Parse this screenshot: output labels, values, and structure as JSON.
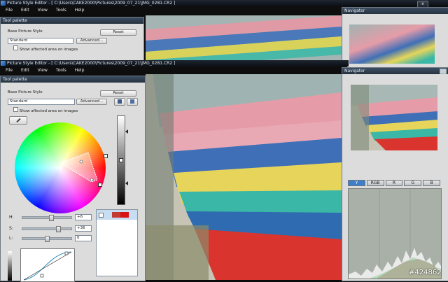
{
  "app": {
    "title_back": "Picture Style Editor - [ C:\\Users\\CAKE2000\\Pictures\\2009_07_21\\JMG_0281.CR2 ]",
    "title_front": "Picture Style Editor - [ C:\\Users\\CAKE2000\\Pictures\\2009_07_21\\JMG_0281.CR2 ]",
    "menu": [
      "File",
      "Edit",
      "View",
      "Tools",
      "Help"
    ],
    "window_buttons": {
      "minimize": "–",
      "maximize": "□",
      "close": "x"
    }
  },
  "tool_palette": {
    "title": "Tool palette",
    "base_style_label": "Base Picture Style",
    "reset_label": "Reset",
    "base_style_value": "Standard",
    "advanced_label": "Advanced...",
    "show_affected_label": "Show affected area on images",
    "h_label": "H:",
    "h_value": "+6",
    "s_label": "S:",
    "s_value": "+36",
    "l_label": "L:",
    "l_value": "0",
    "h_slider_level": 0.6,
    "s_slider_level": 0.75,
    "l_slider_level": 0.5
  },
  "navigator": {
    "title": "Navigator",
    "tabs": [
      "Y",
      "RGB",
      "R",
      "G",
      "B"
    ],
    "selected_tab": "Y"
  },
  "watermark": "#424862",
  "colors": {
    "panel_bg": "#dcdcdc",
    "titlebar": "#0b0f16",
    "navtab_selected": "#3f7fc8"
  }
}
